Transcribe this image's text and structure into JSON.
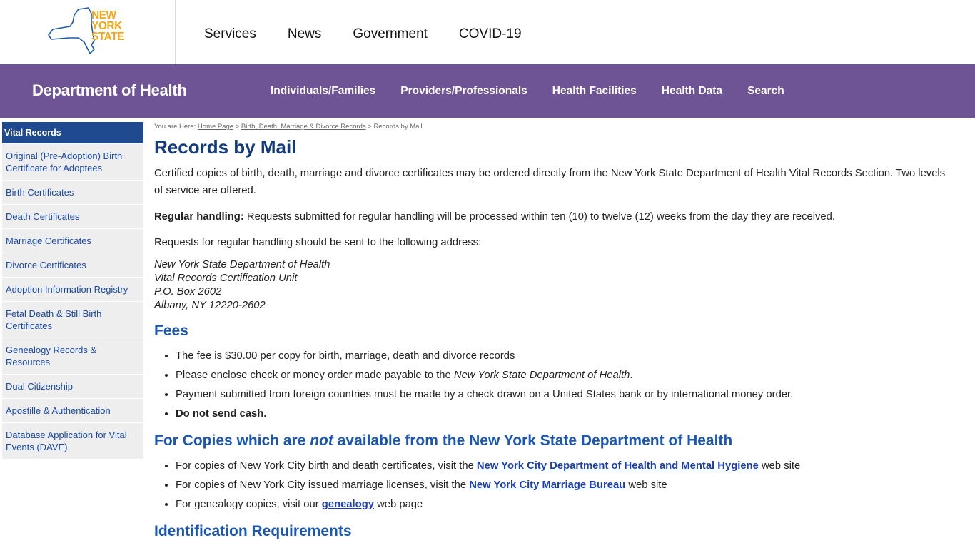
{
  "logo": {
    "line1": "NEW",
    "line2": "YORK",
    "line3": "STATE"
  },
  "state_nav": [
    "Services",
    "News",
    "Government",
    "COVID-19"
  ],
  "department": {
    "title": "Department of Health",
    "nav": [
      "Individuals/Families",
      "Providers/Professionals",
      "Health Facilities",
      "Health Data",
      "Search"
    ]
  },
  "sidebar": {
    "heading": "Vital Records",
    "items": [
      "Original (Pre-Adoption) Birth Certificate for Adoptees",
      "Birth Certificates",
      "Death Certificates",
      "Marriage Certificates",
      "Divorce Certificates",
      "Adoption Information Registry",
      "Fetal Death & Still Birth Certificates",
      "Genealogy Records & Resources",
      "Dual Citizenship",
      "Apostille & Authentication",
      "Database Application for Vital Events (DAVE)"
    ]
  },
  "breadcrumb": {
    "prefix": "You are Here: ",
    "home": "Home Page",
    "sep": " > ",
    "section": "Birth, Death, Marriage & Divorce Records",
    "current": "Records by Mail"
  },
  "main": {
    "title": "Records by Mail",
    "intro": "Certified copies of birth, death, marriage and divorce certificates may be ordered directly from the New York State Department of Health Vital Records Section. Two levels of service are offered.",
    "regular_label": "Regular handling:",
    "regular_text": " Requests submitted for regular handling will be processed within ten (10) to twelve (12) weeks from the day they are received.",
    "send_to": "Requests for regular handling should be sent to the following address:",
    "address": [
      "New York State Department of Health",
      "Vital Records Certification Unit",
      "P.O. Box 2602",
      "Albany, NY 12220-2602"
    ],
    "fees_heading": "Fees",
    "fees": {
      "item1": "The fee is $30.00 per copy for birth, marriage, death and divorce records",
      "item2_pre": "Please enclose check or money order made payable to the ",
      "item2_em": "New York State Department of Health",
      "item2_post": ".",
      "item3": "Payment submitted from foreign countries must be made by a check drawn on a United States bank or by international money order.",
      "item4": "Do not send cash."
    },
    "copies_heading_pre": "For Copies which are ",
    "copies_heading_em": "not",
    "copies_heading_post": " available from the New York State Department of Health",
    "copies": {
      "item1_pre": "For copies of New York City birth and death certificates, visit the ",
      "item1_link": "New York City Department of Health and Mental Hygiene",
      "item1_post": " web site",
      "item2_pre": "For copies of New York City issued marriage licenses, visit the ",
      "item2_link": "New York City Marriage Bureau",
      "item2_post": " web site",
      "item3_pre": "For genealogy copies, visit our ",
      "item3_link": "genealogy",
      "item3_post": " web page"
    },
    "ident_heading": "Identification Requirements"
  }
}
